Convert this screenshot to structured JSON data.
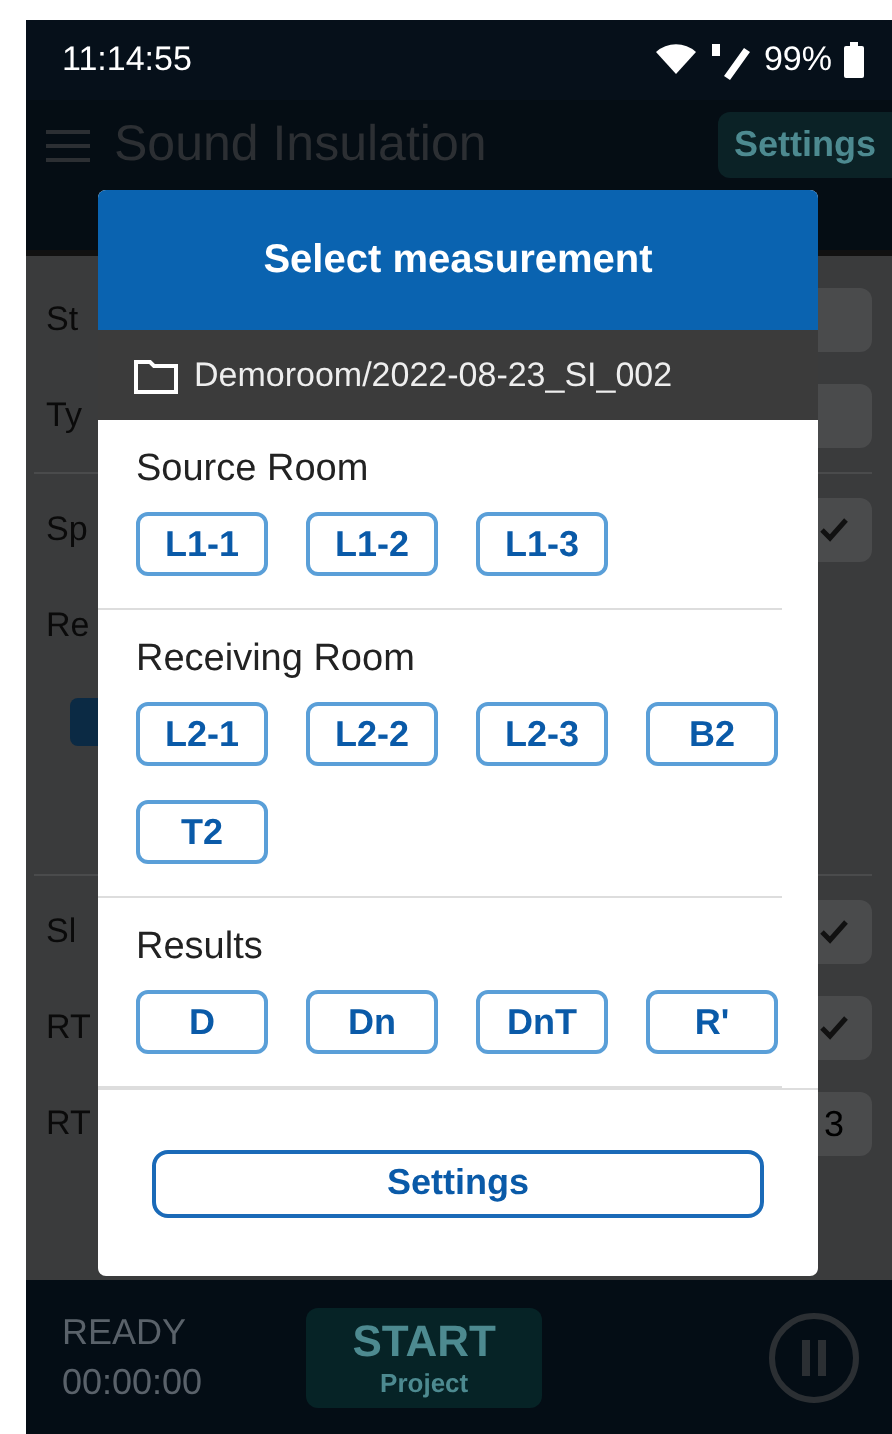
{
  "status_bar": {
    "time": "11:14:55",
    "battery": "99%"
  },
  "app_bar": {
    "title": "Sound Insulation",
    "settings_button": "Settings"
  },
  "background_rows": [
    {
      "label": "St",
      "kind": "field"
    },
    {
      "label": "Ty",
      "kind": "field"
    },
    {
      "kind": "divider"
    },
    {
      "label": "Sp",
      "kind": "check",
      "checked": true
    },
    {
      "label": "Re",
      "kind": "plain"
    },
    {
      "kind": "tick",
      "checked": true
    },
    {
      "kind": "gap"
    },
    {
      "kind": "divider"
    },
    {
      "label": "Sl",
      "kind": "check",
      "checked": true
    },
    {
      "label": "RT",
      "kind": "check",
      "checked": true
    },
    {
      "label": "RT",
      "kind": "value",
      "value": "3"
    }
  ],
  "dialog": {
    "title": "Select measurement",
    "path": "Demoroom/2022-08-23_SI_002",
    "sections": [
      {
        "title": "Source Room",
        "items": [
          "L1-1",
          "L1-2",
          "L1-3"
        ]
      },
      {
        "title": "Receiving Room",
        "items": [
          "L2-1",
          "L2-2",
          "L2-3",
          "B2",
          "T2"
        ]
      },
      {
        "title": "Results",
        "items": [
          "D",
          "Dn",
          "DnT",
          "R'"
        ]
      }
    ],
    "footer_button": "Settings"
  },
  "bottom_bar": {
    "status": "READY",
    "timer": "00:00:00",
    "start_button": {
      "label": "START",
      "sublabel": "Project"
    }
  }
}
